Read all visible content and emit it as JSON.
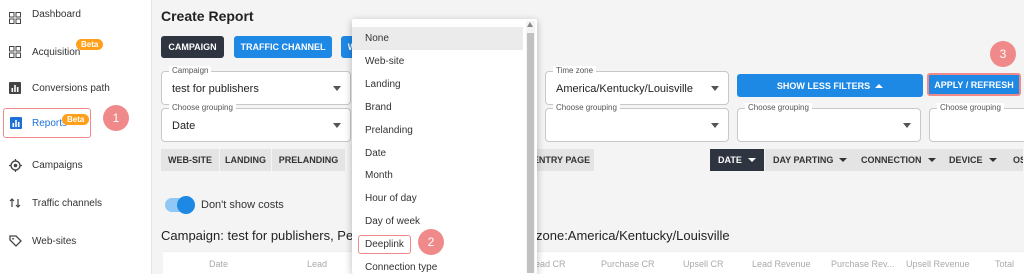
{
  "sidebar": {
    "items": [
      {
        "label": "Dashboard",
        "icon": "dashboard-icon"
      },
      {
        "label": "Acquisition",
        "icon": "grid-icon",
        "badge": "Beta"
      },
      {
        "label": "Conversions path",
        "icon": "bar-chart-icon"
      },
      {
        "label": "Reports",
        "icon": "reports-icon",
        "badge": "Beta",
        "active": true
      },
      {
        "label": "Campaigns",
        "icon": "target-icon"
      },
      {
        "label": "Traffic channels",
        "icon": "arrows-icon"
      },
      {
        "label": "Web-sites",
        "icon": "tag-icon"
      }
    ]
  },
  "steps": {
    "one": "1",
    "two": "2",
    "three": "3"
  },
  "header": {
    "title": "Create Report"
  },
  "top_tabs": {
    "campaign": "CAMPAIGN",
    "traffic_channel": "TRAFFIC CHANNEL",
    "third": "W"
  },
  "filters": {
    "campaign": {
      "label": "Campaign",
      "value": "test for publishers"
    },
    "timezone": {
      "label": "Time zone",
      "value": "America/Kentucky/Louisville"
    },
    "show_less": "SHOW LESS FILTERS",
    "apply": "APPLY / REFRESH"
  },
  "groupings": [
    {
      "label": "Choose grouping",
      "value": "Date"
    },
    {
      "label": "Choose grouping",
      "value": ""
    },
    {
      "label": "Choose grouping",
      "value": ""
    },
    {
      "label": "Choose grouping",
      "value": ""
    }
  ],
  "segments_left": [
    "WEB-SITE",
    "LANDING",
    "PRELANDING"
  ],
  "segment_entry": "ENTRY PAGE",
  "segments_right": [
    "DATE",
    "DAY PARTING",
    "CONNECTION",
    "DEVICE",
    "OS"
  ],
  "toggle_label": "Don't show costs",
  "campaign_line_left": "Campaign: test for publishers, Peri",
  "campaign_line_right": "zone:America/Kentucky/Louisville",
  "table_headers": [
    "Date",
    "Lead",
    "ead CR",
    "Purchase CR",
    "Upsell CR",
    "Lead Revenue",
    "Purchase Rev...",
    "Upsell Revenue",
    "Total"
  ],
  "dropdown": {
    "options": [
      "None",
      "Web-site",
      "Landing",
      "Brand",
      "Prelanding",
      "Date",
      "Month",
      "Hour of day",
      "Day of week",
      "Deeplink",
      "Connection type"
    ],
    "selected": "None",
    "highlighted": "Deeplink"
  },
  "colors": {
    "accent": "#1e88e5",
    "dark": "#2e3440",
    "annotation": "#f08a8a",
    "beta": "#ff9f1a"
  }
}
